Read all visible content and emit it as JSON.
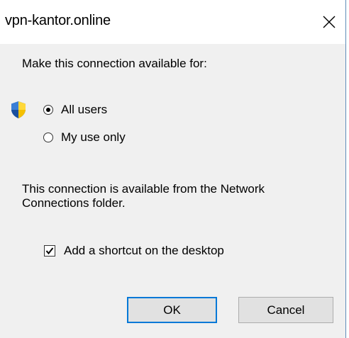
{
  "window": {
    "title": "vpn-kantor.online",
    "close_icon": "close-icon"
  },
  "prompt": "Make this connection available for:",
  "radios": [
    {
      "label": "All users",
      "checked": true,
      "icon": "shield-icon"
    },
    {
      "label": "My use only",
      "checked": false
    }
  ],
  "info_text": "This connection is available from the Network Connections folder.",
  "shortcut": {
    "label": "Add a shortcut on the desktop",
    "checked": true
  },
  "buttons": {
    "ok_label": "OK",
    "cancel_label": "Cancel"
  },
  "colors": {
    "dialog_bg": "#f0f0f0",
    "titlebar_bg": "#ffffff",
    "accent": "#0078d7",
    "shield_blue": "#1f5fb8",
    "shield_yellow": "#f5c000"
  }
}
